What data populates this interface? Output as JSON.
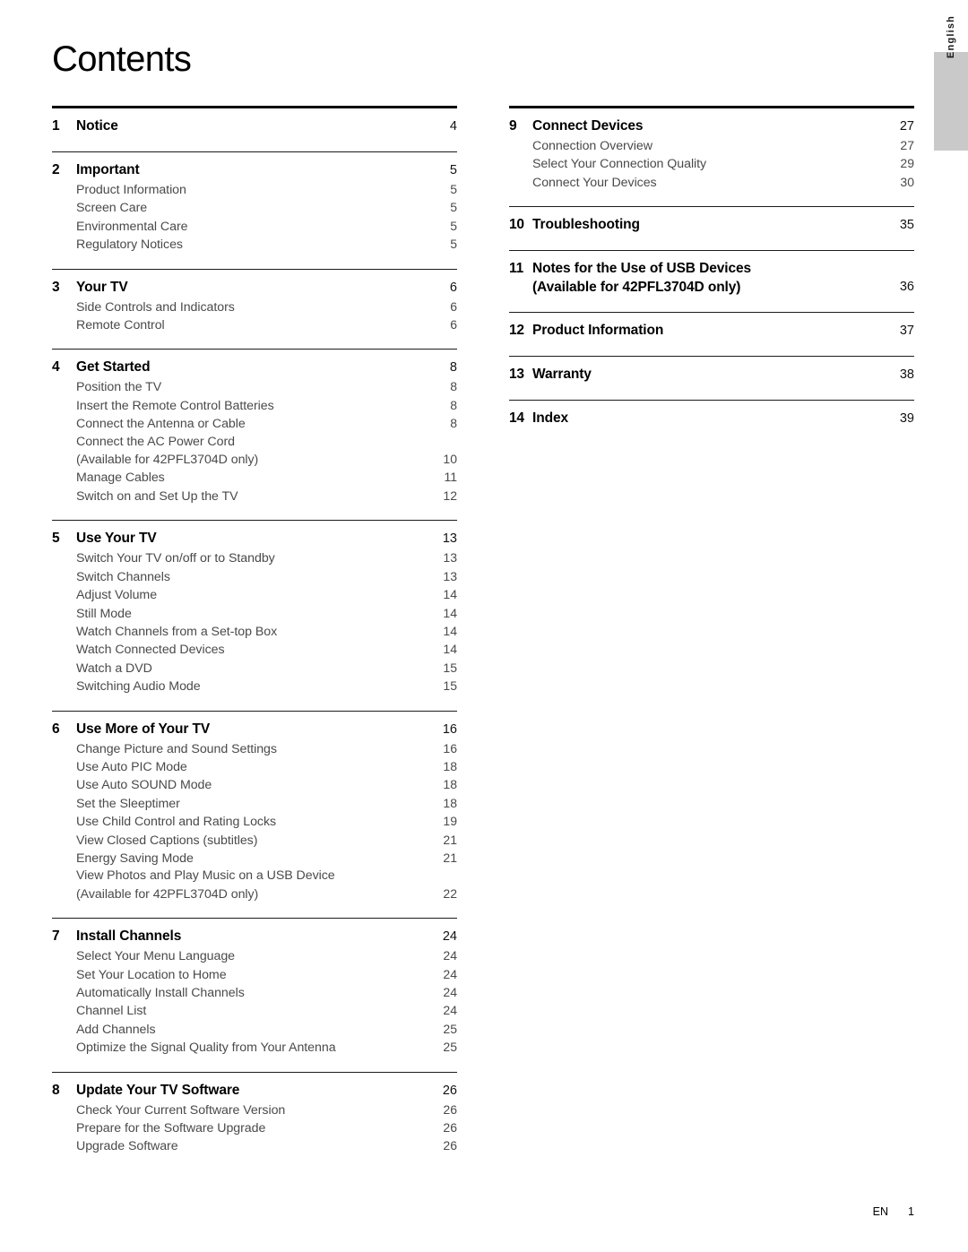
{
  "page_title": "Contents",
  "language_tab": "English",
  "footer": {
    "locale": "EN",
    "page_number": "1"
  },
  "columns": {
    "left": [
      {
        "number": "1",
        "title": "Notice",
        "page": "4",
        "items": []
      },
      {
        "number": "2",
        "title": "Important",
        "page": "5",
        "items": [
          {
            "label": "Product Information",
            "page": "5"
          },
          {
            "label": "Screen Care",
            "page": "5"
          },
          {
            "label": "Environmental Care",
            "page": "5"
          },
          {
            "label": "Regulatory Notices",
            "page": "5"
          }
        ]
      },
      {
        "number": "3",
        "title": "Your TV",
        "page": "6",
        "items": [
          {
            "label": "Side Controls and Indicators",
            "page": "6"
          },
          {
            "label": "Remote Control",
            "page": "6"
          }
        ]
      },
      {
        "number": "4",
        "title": "Get Started",
        "page": "8",
        "items": [
          {
            "label": "Position the TV",
            "page": "8"
          },
          {
            "label": "Insert the Remote Control Batteries",
            "page": "8"
          },
          {
            "label": "Connect the Antenna or Cable",
            "page": "8"
          },
          {
            "label": "Connect the AC Power Cord",
            "page": ""
          },
          {
            "label": "(Available for 42PFL3704D only)",
            "page": "10"
          },
          {
            "label": "Manage Cables",
            "page": "11"
          },
          {
            "label": "Switch on and Set Up the TV",
            "page": "12"
          }
        ]
      },
      {
        "number": "5",
        "title": "Use Your TV",
        "page": "13",
        "items": [
          {
            "label": "Switch Your TV on/off or to Standby",
            "page": "13"
          },
          {
            "label": "Switch Channels",
            "page": "13"
          },
          {
            "label": "Adjust Volume",
            "page": "14"
          },
          {
            "label": "Still Mode",
            "page": "14"
          },
          {
            "label": "Watch Channels from a Set-top Box",
            "page": "14"
          },
          {
            "label": "Watch Connected Devices",
            "page": "14"
          },
          {
            "label": "Watch a DVD",
            "page": "15"
          },
          {
            "label": "Switching Audio Mode",
            "page": "15"
          }
        ]
      },
      {
        "number": "6",
        "title": "Use More of Your TV",
        "page": "16",
        "items": [
          {
            "label": "Change Picture and Sound Settings",
            "page": "16"
          },
          {
            "label": "Use Auto PIC Mode",
            "page": "18"
          },
          {
            "label": "Use Auto SOUND Mode",
            "page": "18"
          },
          {
            "label": "Set the Sleeptimer",
            "page": "18"
          },
          {
            "label": "Use Child Control and Rating Locks",
            "page": "19"
          },
          {
            "label": "View Closed Captions (subtitles)",
            "page": "21"
          },
          {
            "label": "Energy Saving Mode",
            "page": "21"
          },
          {
            "label": "View Photos and Play Music on a USB Device",
            "page": ""
          },
          {
            "label": "(Available for 42PFL3704D only)",
            "page": "22"
          }
        ]
      },
      {
        "number": "7",
        "title": "Install Channels",
        "page": "24",
        "items": [
          {
            "label": "Select Your Menu Language",
            "page": "24"
          },
          {
            "label": "Set Your Location to Home",
            "page": "24"
          },
          {
            "label": "Automatically Install Channels",
            "page": "24"
          },
          {
            "label": "Channel List",
            "page": "24"
          },
          {
            "label": "Add Channels",
            "page": "25"
          },
          {
            "label": "Optimize the Signal Quality from Your Antenna",
            "page": "25"
          }
        ]
      },
      {
        "number": "8",
        "title": "Update Your TV Software",
        "page": "26",
        "items": [
          {
            "label": "Check Your Current Software Version",
            "page": "26"
          },
          {
            "label": "Prepare for the Software Upgrade",
            "page": "26"
          },
          {
            "label": "Upgrade Software",
            "page": "26"
          }
        ]
      }
    ],
    "right": [
      {
        "number": "9",
        "title": "Connect Devices",
        "page": "27",
        "items": [
          {
            "label": "Connection Overview",
            "page": "27"
          },
          {
            "label": "Select Your Connection Quality",
            "page": "29"
          },
          {
            "label": "Connect Your Devices",
            "page": "30"
          }
        ]
      },
      {
        "number": "10",
        "title": "Troubleshooting",
        "page": "35",
        "items": []
      },
      {
        "number": "11",
        "title": "Notes for the Use of USB Devices",
        "title_line2": "(Available for 42PFL3704D only)",
        "page": "36",
        "items": []
      },
      {
        "number": "12",
        "title": "Product Information",
        "page": "37",
        "items": []
      },
      {
        "number": "13",
        "title": "Warranty",
        "page": "38",
        "items": []
      },
      {
        "number": "14",
        "title": "Index",
        "page": "39",
        "items": []
      }
    ]
  }
}
